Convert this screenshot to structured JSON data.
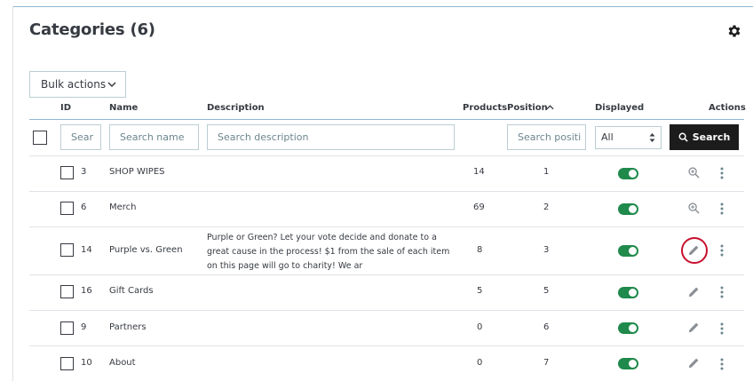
{
  "header": {
    "title": "Categories (6)"
  },
  "toolbar": {
    "bulk_label": "Bulk actions"
  },
  "columns": {
    "id": "ID",
    "name": "Name",
    "description": "Description",
    "products": "Products",
    "position": "Position",
    "displayed": "Displayed",
    "actions": "Actions"
  },
  "filters": {
    "id_placeholder": "Sear",
    "name_placeholder": "Search name",
    "description_placeholder": "Search description",
    "position_placeholder": "Search positi",
    "displayed_value": "All",
    "search_label": "Search"
  },
  "rows": [
    {
      "id": "3",
      "name": "SHOP WIPES",
      "description": "",
      "products": "14",
      "position": "1",
      "displayed": true,
      "action": "zoom-icon"
    },
    {
      "id": "6",
      "name": "Merch",
      "description": "",
      "products": "69",
      "position": "2",
      "displayed": true,
      "action": "zoom-icon"
    },
    {
      "id": "14",
      "name": "Purple vs. Green",
      "description": "Purple or Green? Let your vote decide and donate to a great cause in the process! $1 from the sale of each item on this page will go to charity! We ar",
      "products": "8",
      "position": "3",
      "displayed": true,
      "action": "pencil-icon",
      "highlighted": true
    },
    {
      "id": "16",
      "name": "Gift Cards",
      "description": "",
      "products": "5",
      "position": "5",
      "displayed": true,
      "action": "pencil-icon"
    },
    {
      "id": "9",
      "name": "Partners",
      "description": "",
      "products": "0",
      "position": "6",
      "displayed": true,
      "action": "pencil-icon"
    },
    {
      "id": "10",
      "name": "About",
      "description": "",
      "products": "0",
      "position": "7",
      "displayed": true,
      "action": "pencil-icon"
    }
  ],
  "colors": {
    "toggle_on": "#1f8a4c",
    "highlight": "#c8102e",
    "search_button": "#1c1c1c"
  }
}
